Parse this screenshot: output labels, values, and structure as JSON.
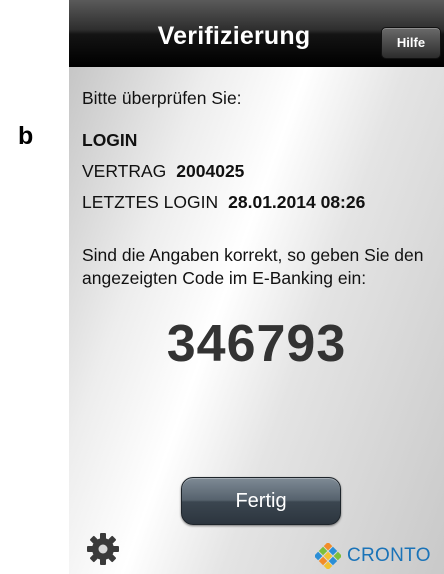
{
  "panel_label": "b",
  "navbar": {
    "title": "Verifizierung",
    "help_label": "Hilfe"
  },
  "content": {
    "prompt": "Bitte überprüfen Sie:",
    "action": "LOGIN",
    "contract_label": "VERTRAG",
    "contract_value": "2004025",
    "last_login_label": "LETZTES LOGIN",
    "last_login_value": "28.01.2014 08:26",
    "question": "Sind die Angaben korrekt, so geben Sie den angezeigten Code im E-Banking ein:",
    "code": "346793"
  },
  "footer": {
    "done_label": "Fertig",
    "settings_icon": "gear-icon",
    "brand_text": "CRONTO",
    "brand_color": "#1a73b8"
  }
}
